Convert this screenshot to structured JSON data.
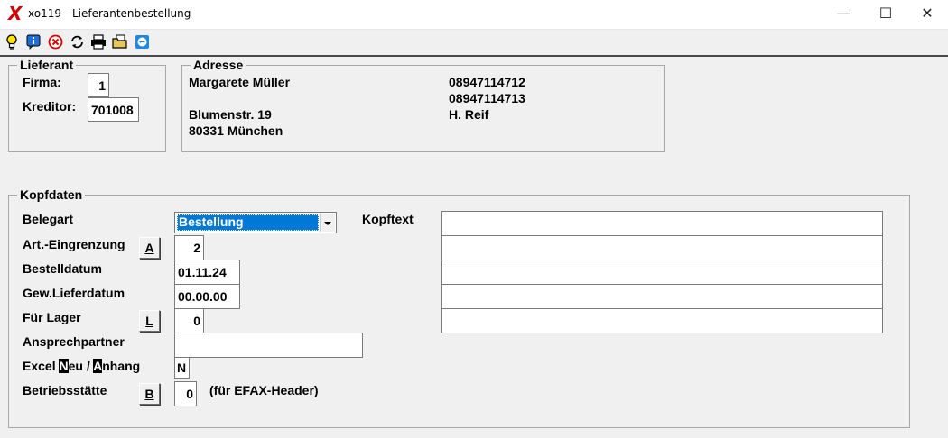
{
  "window": {
    "app_icon_glyph": "X",
    "title": "xo119 - Lieferantenbestellung",
    "minimize": "—",
    "maximize": "☐",
    "close": "✕"
  },
  "toolbar": {
    "icons": [
      "lightbulb-icon",
      "info-icon",
      "cancel-icon",
      "refresh-icon",
      "print-icon",
      "folder-icon",
      "connect-icon"
    ]
  },
  "lieferant": {
    "legend": "Lieferant",
    "firma_label": "Firma:",
    "firma_value": "1",
    "kreditor_label": "Kreditor:",
    "kreditor_value": "701008"
  },
  "adresse": {
    "legend": "Adresse",
    "name": "Margarete Müller",
    "street": "Blumenstr. 19",
    "city": "80331 München",
    "phone1": "08947114712",
    "phone2": "08947114713",
    "contact": "H. Reif"
  },
  "kopfdaten": {
    "legend": "Kopfdaten",
    "belegart_label": "Belegart",
    "belegart_value": "Bestellung",
    "kopftext_label": "Kopftext",
    "kopftext_lines": [
      "",
      "",
      "",
      "",
      ""
    ],
    "art_label": "Art.-Eingrenzung",
    "art_button": "A",
    "art_value": "2",
    "bestelldatum_label": "Bestelldatum",
    "bestelldatum_value": "01.11.24",
    "lieferdatum_label": "Gew.Lieferdatum",
    "lieferdatum_value": "00.00.00",
    "lager_label": "Für Lager",
    "lager_button": "L",
    "lager_value": "0",
    "ansprech_label": "Ansprechpartner",
    "ansprech_value": "",
    "excel_label_pre": "Excel ",
    "excel_hot1": "N",
    "excel_label_mid": "eu / ",
    "excel_hot2": "A",
    "excel_label_post": "nhang",
    "excel_value": "N",
    "betrieb_label": "Betriebsstätte",
    "betrieb_button": "B",
    "betrieb_value": "0",
    "betrieb_note": "(für EFAX-Header)"
  },
  "colors": {
    "selection": "#0078d7",
    "app_icon": "#d40000"
  }
}
